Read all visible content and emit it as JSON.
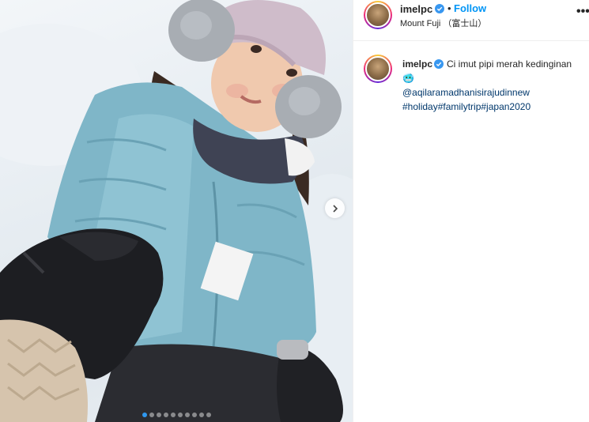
{
  "post": {
    "author": "imelpc",
    "follow_label": "Follow",
    "separator": "•",
    "location": "Mount Fuji （富士山）",
    "more_label": "•••",
    "caption": {
      "text": "Ci imut pipi merah kedinginan 🥶",
      "mention": "@aqilaramadhanisirajudinnew",
      "hashtags": "#holiday#familytrip#japan2020"
    }
  },
  "carousel": {
    "dot_count": 10,
    "active_index": 0
  },
  "colors": {
    "follow": "#0095f6",
    "link": "#00376b",
    "verified": "#3897f0",
    "active_dot": "#2f98f0"
  },
  "icons": {
    "verified": "verified-badge-icon",
    "next": "chevron-right-icon",
    "more": "more-options-icon"
  }
}
